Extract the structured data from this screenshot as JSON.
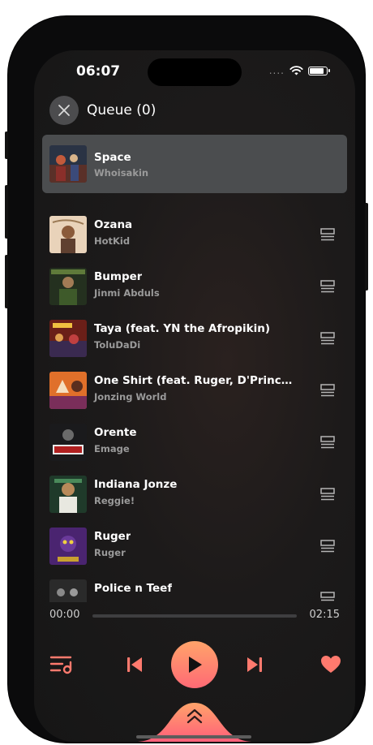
{
  "status": {
    "time": "06:07",
    "signal_dots": "....",
    "battery_level": 0.85
  },
  "header": {
    "title": "Queue (0)",
    "close_icon": "close-icon"
  },
  "now_playing": {
    "title": "Space",
    "artist": "Whoisakin"
  },
  "queue": [
    {
      "title": "Ozana",
      "artist": "HotKid"
    },
    {
      "title": "Bumper",
      "artist": "Jinmi Abduls"
    },
    {
      "title": "Taya (feat. YN the Afropikin)",
      "artist": "ToluDaDi"
    },
    {
      "title": "One Shirt (feat. Ruger, D'Prince & R...",
      "artist": "Jonzing World"
    },
    {
      "title": "Orente",
      "artist": "Emage"
    },
    {
      "title": "Indiana Jonze",
      "artist": "Reggie!"
    },
    {
      "title": "Ruger",
      "artist": "Ruger"
    },
    {
      "title": "Police n Teef",
      "artist": ""
    }
  ],
  "player": {
    "current_time": "00:00",
    "total_time": "02:15",
    "progress": 0
  },
  "colors": {
    "accent": "#ff6f7a",
    "accent_gradient_top": "#ffa36a",
    "background": "#1c1a1a"
  },
  "icons": {
    "queue": "queue-music-icon",
    "previous": "skip-previous-icon",
    "play": "play-icon",
    "next": "skip-next-icon",
    "favorite": "heart-icon",
    "expand": "chevron-double-up-icon",
    "drag": "drag-handle-icon"
  }
}
